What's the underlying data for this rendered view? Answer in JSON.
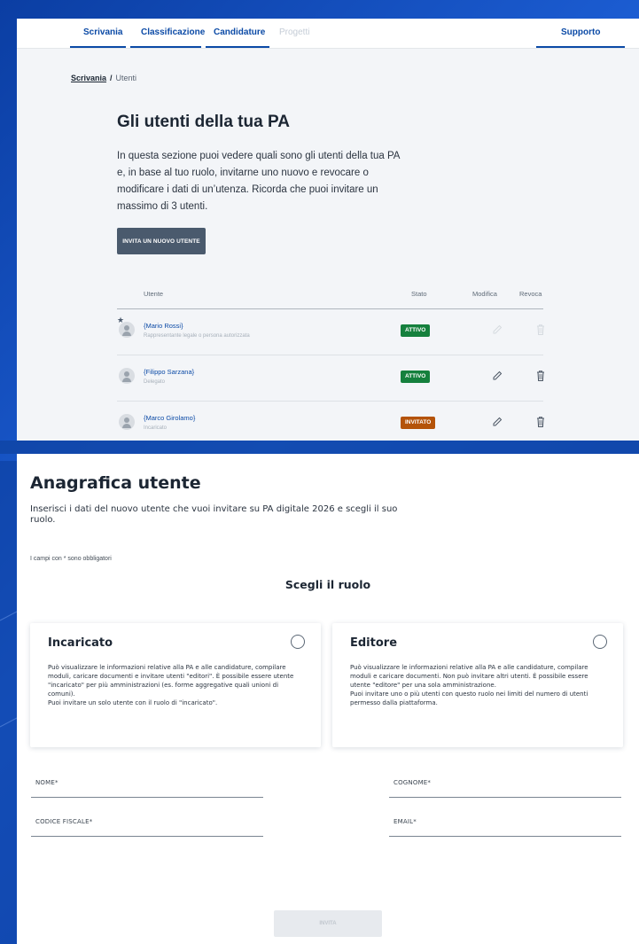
{
  "nav": {
    "items": [
      {
        "label": "Scrivania"
      },
      {
        "label": "Classificazione"
      },
      {
        "label": "Candidature"
      },
      {
        "label": "Progetti"
      }
    ],
    "support": "Supporto"
  },
  "breadcrumb": {
    "root": "Scrivania",
    "sep": "/",
    "current": "Utenti"
  },
  "users_page": {
    "title": "Gli utenti della tua PA",
    "description": "In questa sezione puoi vedere quali sono gli utenti della tua PA e, in base al tuo ruolo, invitarne uno nuovo e revocare o modificare i dati di un’utenza. Ricorda che puoi invitare un massimo di 3 utenti.",
    "invite_button": "INVITA UN NUOVO UTENTE"
  },
  "table": {
    "headers": {
      "user": "Utente",
      "status": "Stato",
      "edit": "Modifica",
      "revoke": "Revoca"
    },
    "rows": [
      {
        "name": "{Mario Rossi}",
        "role": "Rappresentante legale o persona autorizzata",
        "status": "ATTIVO",
        "status_type": "active",
        "owner": true,
        "actions_enabled": false
      },
      {
        "name": "{Filippo Sarzana}",
        "role": "Delegato",
        "status": "ATTIVO",
        "status_type": "active",
        "owner": false,
        "actions_enabled": true
      },
      {
        "name": "{Marco Girolamo}",
        "role": "Incaricato",
        "status": "INVITATO",
        "status_type": "invited",
        "owner": false,
        "actions_enabled": true
      }
    ]
  },
  "anagrafica": {
    "title": "Anagrafica utente",
    "description": "Inserisci i dati del nuovo utente che vuoi invitare su PA digitale 2026 e scegli il suo ruolo.",
    "required_note": "I campi con * sono obbligatori",
    "role_heading": "Scegli il ruolo",
    "roles": [
      {
        "title": "Incaricato",
        "text": "Può visualizzare le informazioni relative alla PA e alle candidature, compilare moduli, caricare documenti e invitare utenti \"editori\". È possibile essere utente \"incaricato\" per più amministrazioni (es. forme aggregative quali unioni di comuni).\nPuoi invitare un solo utente con il ruolo di \"incaricato\"."
      },
      {
        "title": "Editore",
        "text": "Può visualizzare le informazioni relative alla PA e alle candidature, compilare moduli e caricare documenti. Non può invitare altri utenti. È possibile essere utente \"editore\" per una sola amministrazione.\nPuoi invitare uno o più utenti con questo ruolo nei limiti del numero di utenti permesso dalla piattaforma."
      }
    ],
    "fields": {
      "nome": "NOME*",
      "cognome": "COGNOME*",
      "codice_fiscale": "CODICE FISCALE*",
      "email": "EMAIL*"
    },
    "submit": "INVITA"
  },
  "colors": {
    "brand": "#0b4aa6",
    "background": "#1d5fd6",
    "active_badge": "#15803d",
    "invited_badge": "#b45309",
    "invite_button": "#4a5a6d"
  },
  "icons": {
    "edit": "pencil-icon",
    "revoke": "trash-icon",
    "owner": "star-icon",
    "user": "avatar-icon",
    "role_select": "radio-icon"
  }
}
